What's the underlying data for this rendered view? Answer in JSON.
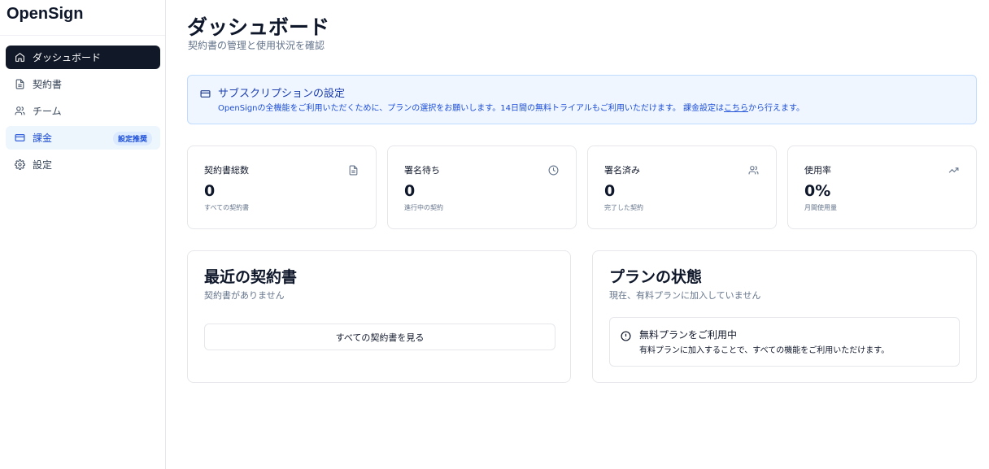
{
  "app": {
    "brand": "OpenSign"
  },
  "sidebar": {
    "items": [
      {
        "label": "ダッシュボード",
        "icon": "home-icon"
      },
      {
        "label": "契約書",
        "icon": "document-icon"
      },
      {
        "label": "チーム",
        "icon": "users-icon"
      },
      {
        "label": "課金",
        "icon": "credit-card-icon",
        "badge": "設定推奨"
      },
      {
        "label": "設定",
        "icon": "gear-icon"
      }
    ]
  },
  "header": {
    "title": "ダッシュボード",
    "subtitle": "契約書の管理と使用状況を確認"
  },
  "banner": {
    "title": "サブスクリプションの設定",
    "text_before": "OpenSignの全機能をご利用いただくために、プランの選択をお願いします。14日間の無料トライアルもご利用いただけます。 課金設定は",
    "link": "こちら",
    "text_after": "から行えます。"
  },
  "stats": [
    {
      "label": "契約書総数",
      "value": "0",
      "sub": "すべての契約書",
      "icon": "file-icon"
    },
    {
      "label": "署名待ち",
      "value": "0",
      "sub": "進行中の契約",
      "icon": "clock-icon"
    },
    {
      "label": "署名済み",
      "value": "0",
      "sub": "完了した契約",
      "icon": "users-icon"
    },
    {
      "label": "使用率",
      "value": "0%",
      "sub": "月間使用量",
      "icon": "trending-up-icon"
    }
  ],
  "recent": {
    "title": "最近の契約書",
    "empty": "契約書がありません",
    "button": "すべての契約書を見る"
  },
  "plan": {
    "title": "プランの状態",
    "subtitle": "現在、有料プランに加入していません",
    "alert_title": "無料プランをご利用中",
    "alert_text": "有料プランに加入することで、すべての機能をご利用いただけます。"
  },
  "colors": {
    "primary": "#111827",
    "accent": "#1d4ed8",
    "banner_bg": "#eff6ff"
  }
}
